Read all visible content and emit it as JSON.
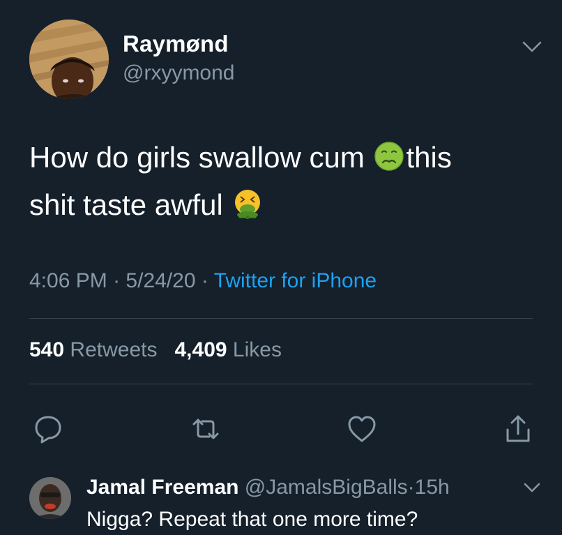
{
  "tweet": {
    "author_name": "Raymønd",
    "author_handle": "@rxyymond",
    "text_line1": "How do girls swallow cum",
    "text_line1_end": "this",
    "text_line2": "shit taste awful",
    "emoji_1": "nauseated-face-icon",
    "emoji_2": "vomiting-face-icon",
    "time": "4:06 PM",
    "separator": "·",
    "date": "5/24/20",
    "source": "Twitter for iPhone",
    "retweets_count": "540",
    "retweets_label": "Retweets",
    "likes_count": "4,409",
    "likes_label": "Likes"
  },
  "reply": {
    "author_name": "Jamal Freeman",
    "author_handle": "@JamalsBigBalls",
    "separator": "·",
    "time": "15h",
    "text": "Nigga? Repeat that one more time?"
  },
  "colors": {
    "background": "#15202b",
    "secondary_text": "#8899a6",
    "link": "#1da1f2",
    "divider": "#38444d"
  }
}
